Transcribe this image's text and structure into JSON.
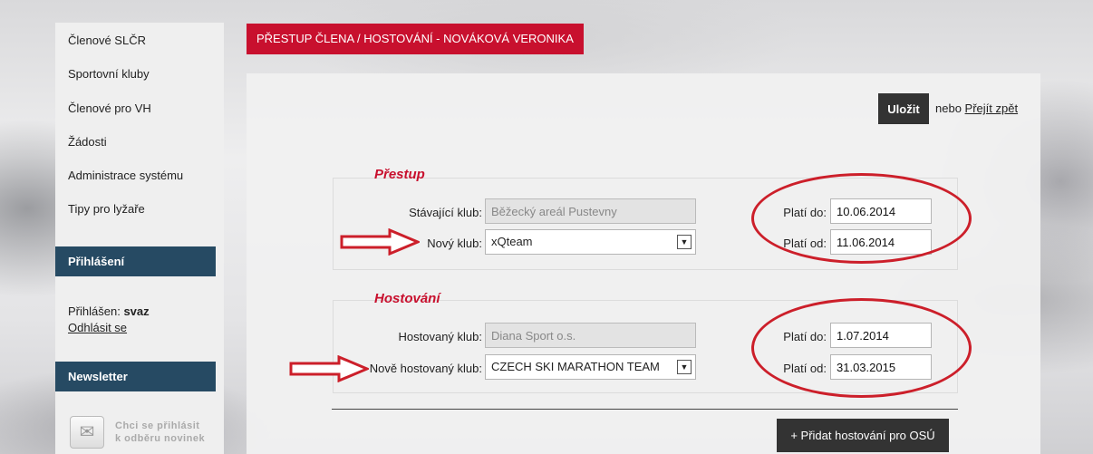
{
  "sidebar": {
    "nav": [
      "Členové SLČR",
      "Sportovní kluby",
      "Členové pro VH",
      "Žádosti",
      "Administrace systému",
      "Tipy pro lyžaře"
    ],
    "login_heading": "Přihlášení",
    "login_prefix": "Přihlášen:",
    "login_user": "svaz",
    "logout": "Odhlásit se",
    "newsletter_heading": "Newsletter",
    "newsletter_line1": "Chci se přihlásit",
    "newsletter_line2": "k odběru novinek"
  },
  "header": {
    "title": "PŘESTUP ČLENA / HOSTOVÁNÍ - NOVÁKOVÁ VERONIKA"
  },
  "actions": {
    "save": "Uložit",
    "or": "nebo",
    "back": "Přejít zpět",
    "add_guest": "+ Přidat hostování pro OSÚ"
  },
  "transfer": {
    "title": "Přestup",
    "current_club_label": "Stávající klub:",
    "current_club_value": "Běžecký areál Pustevny",
    "new_club_label": "Nový klub:",
    "new_club_value": "xQteam",
    "valid_to_label": "Platí do:",
    "valid_to_value": "10.06.2014",
    "valid_from_label": "Platí od:",
    "valid_from_value": "11.06.2014"
  },
  "guest": {
    "title": "Hostování",
    "host_club_label": "Hostovaný klub:",
    "host_club_value": "Diana Sport o.s.",
    "new_host_label": "Nově hostovaný klub:",
    "new_host_value": "CZECH SKI MARATHON TEAM",
    "valid_to_label": "Platí do:",
    "valid_to_value": "1.07.2014",
    "valid_from_label": "Platí od:",
    "valid_from_value": "31.03.2015"
  },
  "colors": {
    "accent_red": "#c8102e",
    "sidebar_heading": "#264a63",
    "annotation_red": "#cc1f2a"
  }
}
